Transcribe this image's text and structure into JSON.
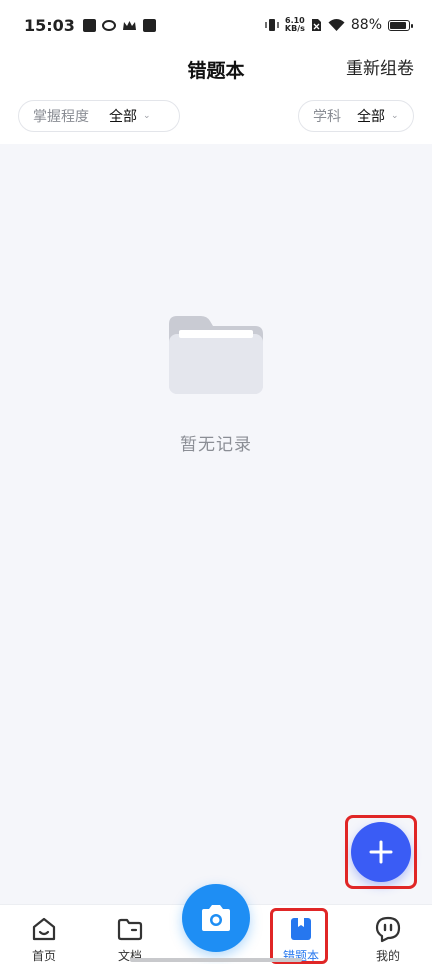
{
  "status_bar": {
    "time": "15:03",
    "net_speed_value": "6.10",
    "net_speed_unit": "KB/s",
    "battery_percent": "88%",
    "battery_level": 0.88
  },
  "header": {
    "title": "错题本",
    "regroup_label": "重新组卷"
  },
  "filters": {
    "mastery": {
      "label": "掌握程度",
      "value": "全部"
    },
    "subject": {
      "label": "学科",
      "value": "全部"
    }
  },
  "empty_state": {
    "text": "暂无记录",
    "icon": "folder-icon"
  },
  "fab": {
    "icon": "plus-icon"
  },
  "bottom_nav": {
    "items": [
      {
        "label": "首页",
        "icon": "home-icon"
      },
      {
        "label": "文档",
        "icon": "folder-icon"
      },
      {
        "label": "错题本",
        "icon": "bookmark-book-icon",
        "active": true
      },
      {
        "label": "我的",
        "icon": "chat-face-icon"
      }
    ],
    "camera_icon": "camera-icon"
  },
  "colors": {
    "accent": "#3a5cf5",
    "camera": "#1e8ef4",
    "active_tab": "#2677ef",
    "highlight": "#e02626",
    "background": "#f5f6fa"
  }
}
